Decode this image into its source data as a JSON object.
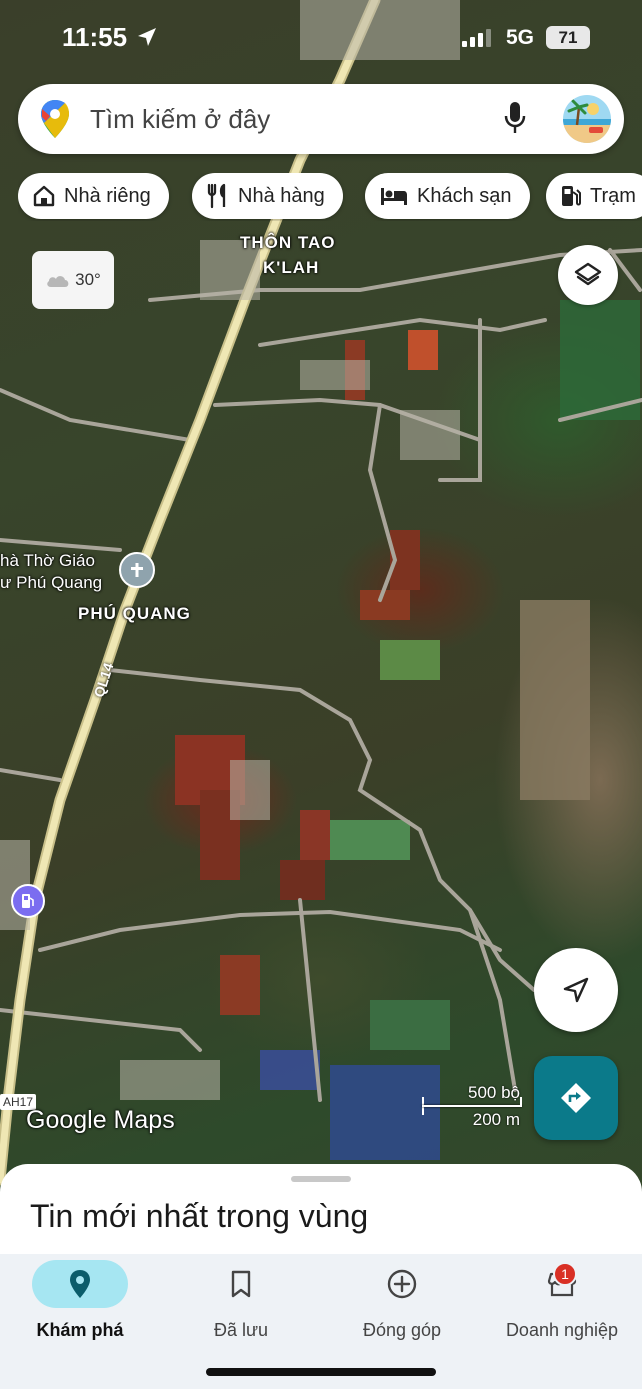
{
  "status_bar": {
    "time": "11:55",
    "network": "5G",
    "battery": "71"
  },
  "search": {
    "placeholder": "Tìm kiếm ở đây"
  },
  "chips": [
    {
      "label": "Nhà riêng",
      "icon": "home-icon"
    },
    {
      "label": "Nhà hàng",
      "icon": "restaurant-icon"
    },
    {
      "label": "Khách sạn",
      "icon": "hotel-icon"
    },
    {
      "label": "Trạm",
      "icon": "gas-station-icon"
    }
  ],
  "weather": {
    "temperature": "30°",
    "icon": "cloud-icon"
  },
  "map": {
    "place_labels": [
      "THÔN TAO",
      "K'LAH",
      "PHÚ QUANG"
    ],
    "poi_label_line1": "hà Thờ Giáo",
    "poi_label_line2": "ư Phú Quang",
    "road_label": "QL14",
    "road_shield": "AH17",
    "scale_top": "500 bộ",
    "scale_bottom": "200 m",
    "brand": "Google Maps"
  },
  "sheet": {
    "title": "Tin mới nhất trong vùng"
  },
  "tabs": [
    {
      "label": "Khám phá",
      "icon": "explore-pin-icon",
      "active": true
    },
    {
      "label": "Đã lưu",
      "icon": "bookmark-icon"
    },
    {
      "label": "Đóng góp",
      "icon": "add-circle-icon"
    },
    {
      "label": "Doanh nghiệp",
      "icon": "store-icon",
      "badge": "1"
    }
  ],
  "colors": {
    "accent": "#0b7a8a",
    "active_tab_pill": "#a6e6f2",
    "badge": "#d93025"
  }
}
